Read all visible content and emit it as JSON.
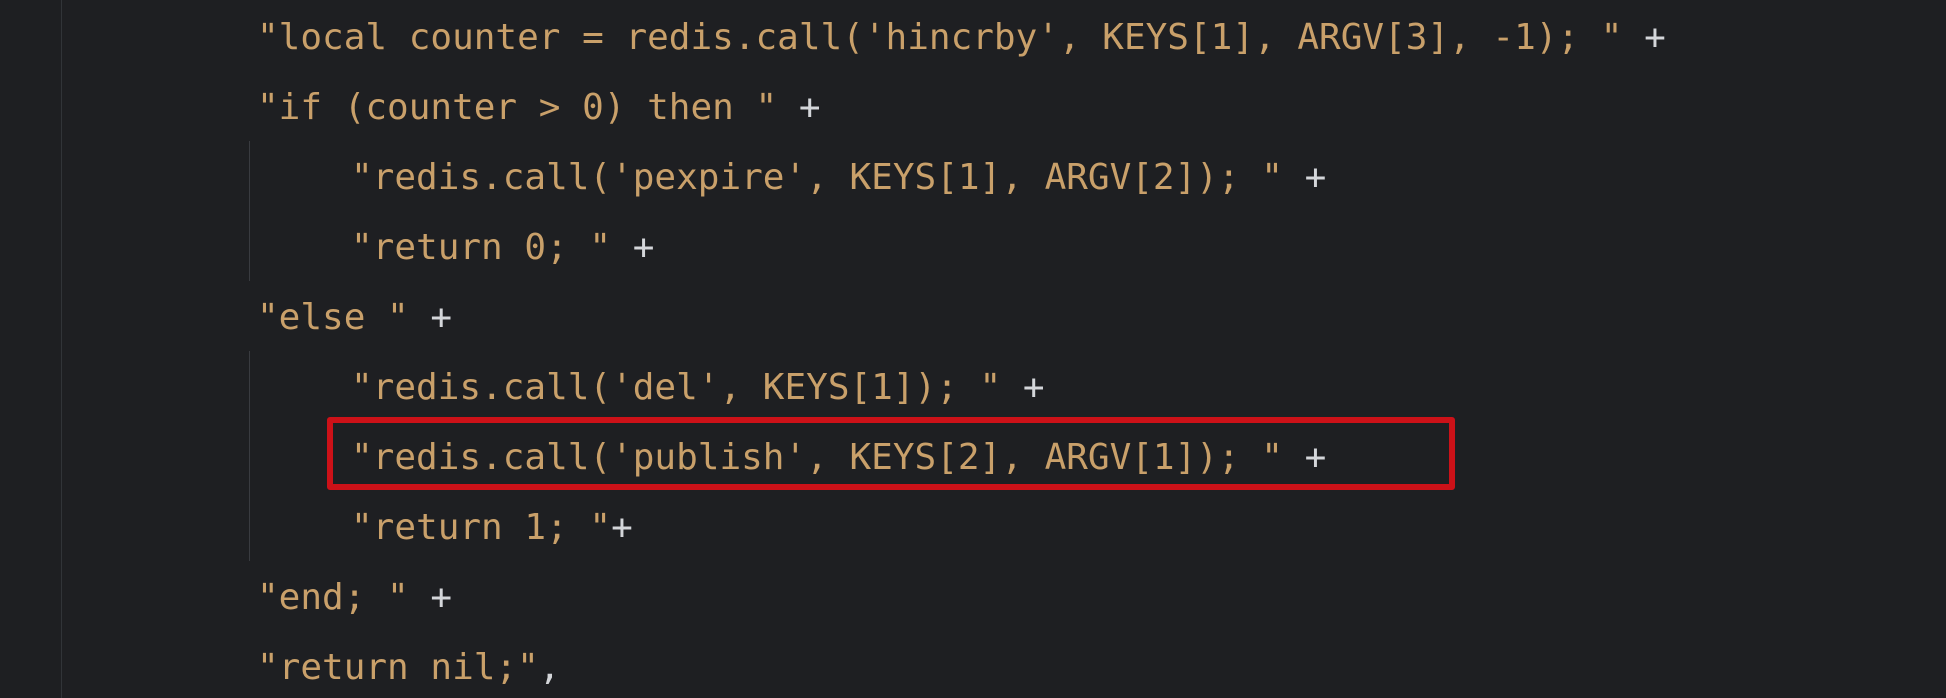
{
  "editor": {
    "lines": [
      {
        "text": "\"local counter = redis.call('hincrby', KEYS[1], ARGV[3], -1); \"",
        "op": " +"
      },
      {
        "text": "\"if (counter > 0) then \"",
        "op": " +"
      },
      {
        "text": "\"redis.call('pexpire', KEYS[1], ARGV[2]); \"",
        "op": " +"
      },
      {
        "text": "\"return 0; \"",
        "op": " +"
      },
      {
        "text": "\"else \"",
        "op": " +"
      },
      {
        "text": "\"redis.call('del', KEYS[1]); \"",
        "op": " +"
      },
      {
        "text": "\"redis.call('publish', KEYS[2], ARGV[1]); \"",
        "op": " +"
      },
      {
        "text": "\"return 1; \"",
        "op": "+"
      },
      {
        "text": "\"end; \"",
        "op": " +"
      },
      {
        "text": "\"return nil;\"",
        "op": ","
      }
    ],
    "colors": {
      "background": "#1e1f22",
      "string": "#c9a06a",
      "operator": "#d4d6da",
      "highlight_border": "#cc1118"
    }
  }
}
